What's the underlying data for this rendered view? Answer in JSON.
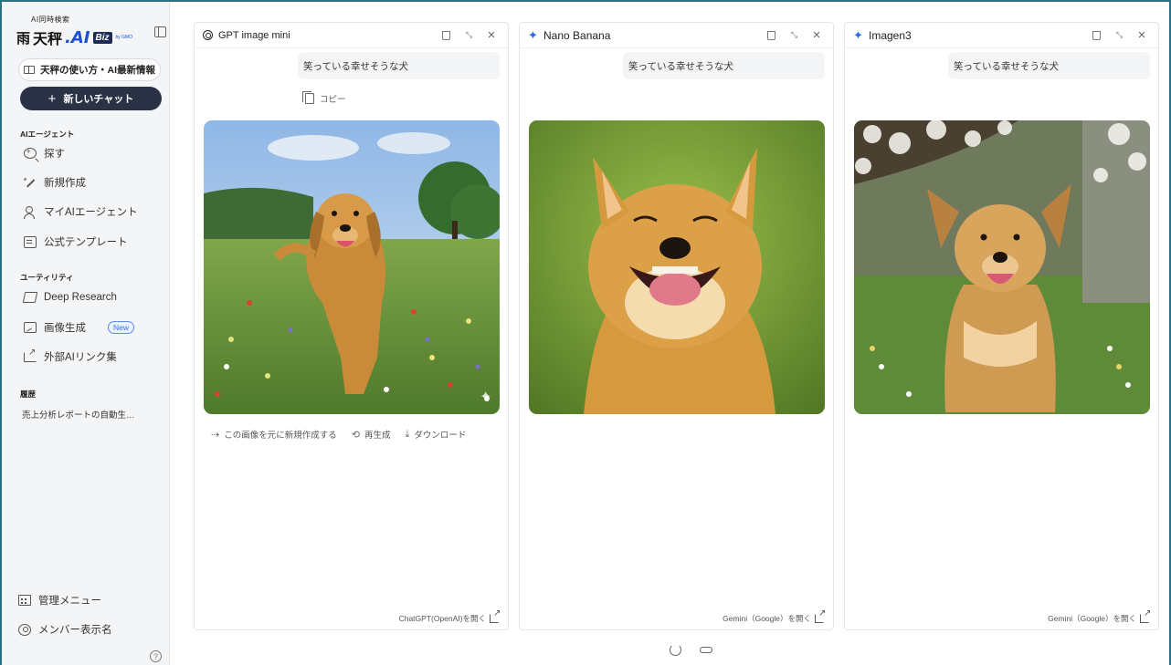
{
  "brand": {
    "tagline": "AI同時検索",
    "mark": "⾬",
    "name": "天秤",
    "ai": ".AI",
    "biz": "Biz",
    "gmo": "by GMO"
  },
  "sidebar": {
    "guide_label": "天秤の使い方・AI最新情報",
    "new_chat_label": "新しいチャット",
    "agent_section": "AIエージェント",
    "agent_items": [
      {
        "label": "探す",
        "icon": "search-icon"
      },
      {
        "label": "新規作成",
        "icon": "pen-icon"
      },
      {
        "label": "マイAIエージェント",
        "icon": "user-icon"
      },
      {
        "label": "公式テンプレート",
        "icon": "template-icon"
      }
    ],
    "utility_section": "ユーティリティ",
    "utility_items": [
      {
        "label": "Deep Research",
        "icon": "research-icon"
      },
      {
        "label": "画像生成",
        "icon": "image-icon",
        "badge": "New"
      },
      {
        "label": "外部AIリンク集",
        "icon": "external-link-icon"
      }
    ],
    "history_section": "履歴",
    "history_items": [
      "売上分析レポートの自動生…"
    ],
    "admin_label": "管理メニュー",
    "member_label": "メンバー表示名",
    "help": "?"
  },
  "panels": [
    {
      "title": "GPT image mini",
      "prompt": "笑っている幸せそうな犬",
      "copy_label": "コピー",
      "actions": [
        "この画像を元に新規作成する",
        "再生成",
        "ダウンロード"
      ],
      "open_link": "ChatGPT(OpenAI)を開く"
    },
    {
      "title": "Nano Banana",
      "prompt": "笑っている幸せそうな犬",
      "open_link": "Gemini（Google）を開く"
    },
    {
      "title": "Imagen3",
      "prompt": "笑っている幸せそうな犬",
      "open_link": "Gemini（Google）を開く"
    }
  ],
  "colors": {
    "accent": "#2f6ae8",
    "new_chat_bg": "#2a3245",
    "frame": "#2f6f86"
  }
}
